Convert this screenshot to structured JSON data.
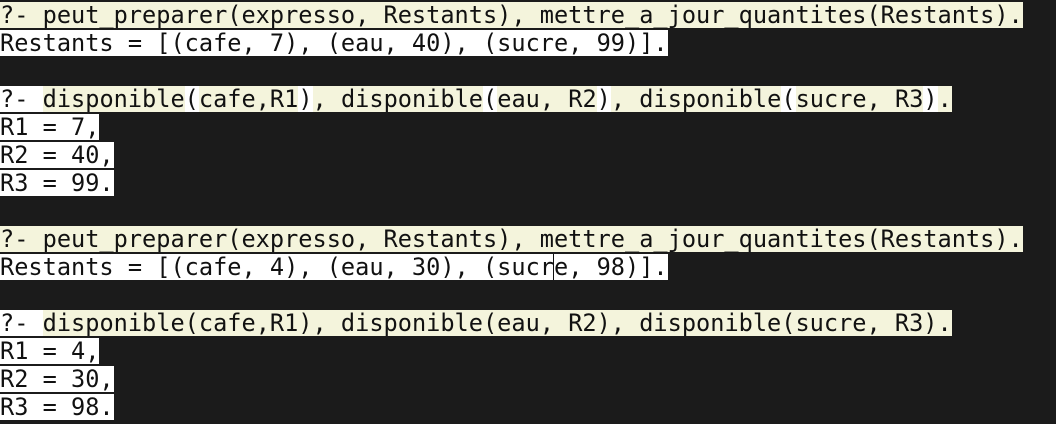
{
  "lines": [
    [
      {
        "t": "?- peut_preparer(expresso, Restants), mettre_a_jour_quantites(Restants).",
        "bg": "cream"
      }
    ],
    [
      {
        "t": "Restants = [(cafe, 7), (eau, 40), (sucre, 99)].",
        "bg": "white"
      }
    ],
    [],
    [
      {
        "t": "?- ",
        "bg": "white"
      },
      {
        "t": "disponible",
        "bg": "cream"
      },
      {
        "t": "(",
        "bg": "white"
      },
      {
        "t": "cafe,R1",
        "bg": "cream"
      },
      {
        "t": ")",
        "bg": "white"
      },
      {
        "t": ", disponible",
        "bg": "cream"
      },
      {
        "t": "(",
        "bg": "white"
      },
      {
        "t": "eau, R2",
        "bg": "cream"
      },
      {
        "t": ")",
        "bg": "white"
      },
      {
        "t": ", disponible",
        "bg": "cream"
      },
      {
        "t": "(",
        "bg": "white"
      },
      {
        "t": "sucre, R3",
        "bg": "cream"
      },
      {
        "t": ")",
        "bg": "white"
      },
      {
        "t": ".",
        "bg": "cream"
      }
    ],
    [
      {
        "t": "R1 = 7,",
        "bg": "white"
      }
    ],
    [
      {
        "t": "R2 = 40,",
        "bg": "white"
      }
    ],
    [
      {
        "t": "R3 = 99.",
        "bg": "white"
      }
    ],
    [],
    [
      {
        "t": "?- peut_preparer(expresso, Restants), mettre_a_jour_quantites(Restants).",
        "bg": "cream"
      }
    ],
    [
      {
        "t": "Restants = [(cafe, 4), (eau, 30), (sucr",
        "bg": "white"
      },
      {
        "t": "",
        "bg": "cursor"
      },
      {
        "t": "e, 98)].",
        "bg": "white"
      }
    ],
    [],
    [
      {
        "t": "?- ",
        "bg": "white"
      },
      {
        "t": "disponible(cafe,R1), disponible(eau, R2), disponible(sucre, R3).",
        "bg": "cream"
      }
    ],
    [
      {
        "t": "R1 = 4,",
        "bg": "white"
      }
    ],
    [
      {
        "t": "R2 = 30,",
        "bg": "white"
      }
    ],
    [
      {
        "t": "R3 = 98.",
        "bg": "white"
      }
    ]
  ],
  "colors": {
    "background": "#1b1b1b",
    "cream": "#f4f4dc",
    "white": "#ffffff",
    "text": "#111111"
  }
}
